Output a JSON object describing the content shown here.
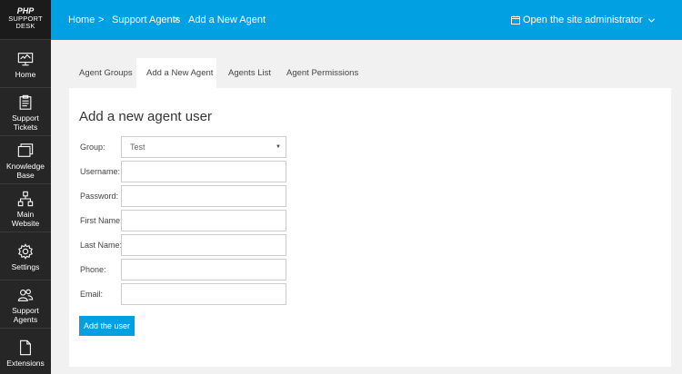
{
  "logo": {
    "line1": "PHP",
    "line2": "SUPPORT",
    "line3": "DESK"
  },
  "sidebar": {
    "items": [
      {
        "label": "Home",
        "icon": "monitor-icon"
      },
      {
        "label": "Support\nTickets",
        "icon": "clipboard-icon"
      },
      {
        "label": "Knowledge\nBase",
        "icon": "windows-icon"
      },
      {
        "label": "Main\nWebsite",
        "icon": "sitemap-icon"
      },
      {
        "label": "Settings",
        "icon": "gear-icon"
      },
      {
        "label": "Support\nAgents",
        "icon": "users-icon"
      },
      {
        "label": "Extensions",
        "icon": "document-icon"
      }
    ]
  },
  "topbar": {
    "breadcrumb": [
      "Home",
      "Support Agents",
      "Add a New Agent"
    ],
    "separator": ">",
    "open_site": "Open the site",
    "user": "administrator"
  },
  "tabs": [
    "Agent Groups",
    "Add a New Agent",
    "Agents List",
    "Agent Permissions"
  ],
  "active_tab": "Add a New Agent",
  "form": {
    "title": "Add a new agent user",
    "group_label": "Group:",
    "group_value": "Test",
    "username_label": "Username:",
    "password_label": "Password:",
    "first_name_label": "First Name:",
    "last_name_label": "Last Name:",
    "phone_label": "Phone:",
    "email_label": "Email:",
    "submit_label": "Add the user"
  },
  "colors": {
    "accent": "#00a0e3",
    "sidebar": "#262626"
  }
}
